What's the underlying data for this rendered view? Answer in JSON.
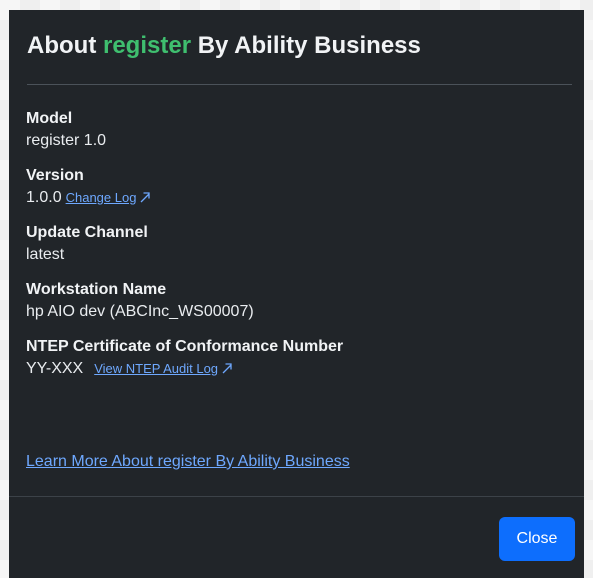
{
  "dialog": {
    "title_prefix": "About",
    "title_app": "register",
    "title_suffix": "By Ability Business"
  },
  "fields": {
    "model": {
      "label": "Model",
      "value": "register 1.0"
    },
    "version": {
      "label": "Version",
      "value": "1.0.0",
      "link": "Change Log"
    },
    "update_channel": {
      "label": "Update Channel",
      "value": "latest"
    },
    "workstation": {
      "label": "Workstation Name",
      "value": "hp AIO dev (ABCInc_WS00007)"
    },
    "ntep": {
      "label": "NTEP Certificate of Conformance Number",
      "value": "YY-XXX",
      "link": "View NTEP Audit Log"
    }
  },
  "learn_more": "Learn More About register By Ability Business",
  "footer": {
    "close_label": "Close"
  },
  "colors": {
    "modal_bg": "#212529",
    "accent_green": "#3fbf6f",
    "link_blue": "#6ea8fe",
    "button_blue": "#0d6efd"
  },
  "icons": {
    "external_link": "external-link-icon"
  }
}
